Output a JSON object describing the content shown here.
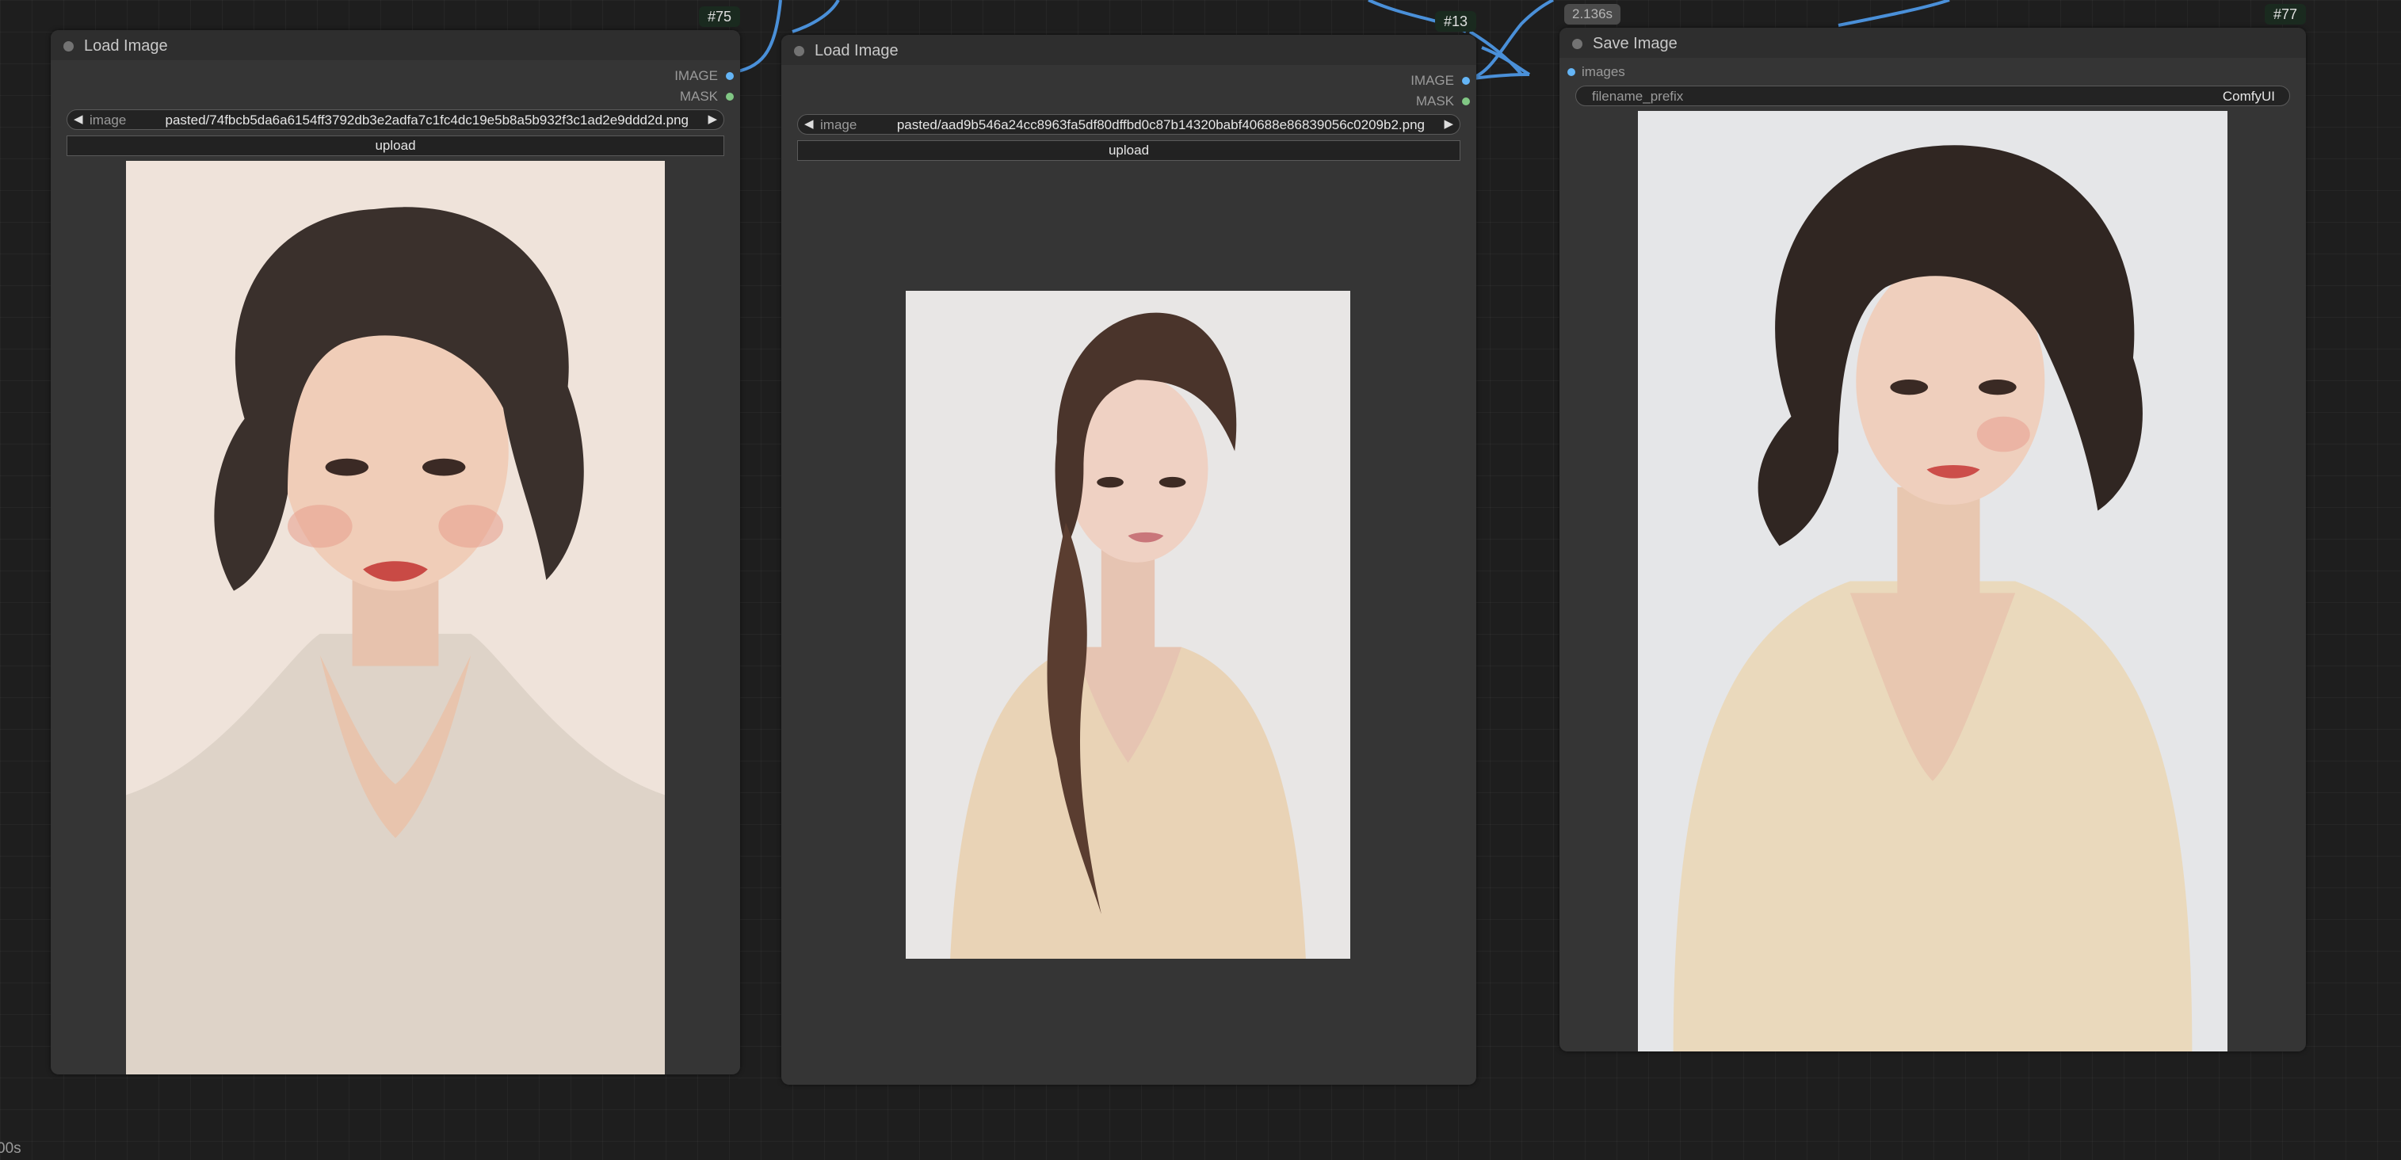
{
  "canvas": {
    "status_text": "00s"
  },
  "nodes": [
    {
      "id": "#75",
      "title": "Load Image",
      "outputs": [
        "IMAGE",
        "MASK"
      ],
      "widget": {
        "name": "image",
        "value": "pasted/74fbcb5da6a6154ff3792db3e2adfa7c1fc4dc19e5b8a5b932f3c1ad2e9ddd2d.png"
      },
      "button": "upload",
      "preview": "portrait of young woman with short curly dark hair in beige v-neck sweater"
    },
    {
      "id": "#13",
      "title": "Load Image",
      "outputs": [
        "IMAGE",
        "MASK"
      ],
      "widget": {
        "name": "image",
        "value": "pasted/aad9b546a24cc8963fa5df80dffbd0c87b14320babf40688e86839056c0209b2.png"
      },
      "button": "upload",
      "preview": "portrait of young woman with long brown braid in cream satin top"
    },
    {
      "id": "#77",
      "title": "Save Image",
      "timer": "2.136s",
      "inputs": [
        "images"
      ],
      "widget": {
        "name": "filename_prefix",
        "value": "ComfyUI"
      },
      "preview": "portrait of young woman with short curly dark hair in cream camisole"
    }
  ],
  "colors": {
    "link": "#4a90d9",
    "image_slot": "#64b5f6",
    "mask_slot": "#81c784",
    "node_bg": "#353535",
    "canvas_bg": "#1e1e1e"
  }
}
